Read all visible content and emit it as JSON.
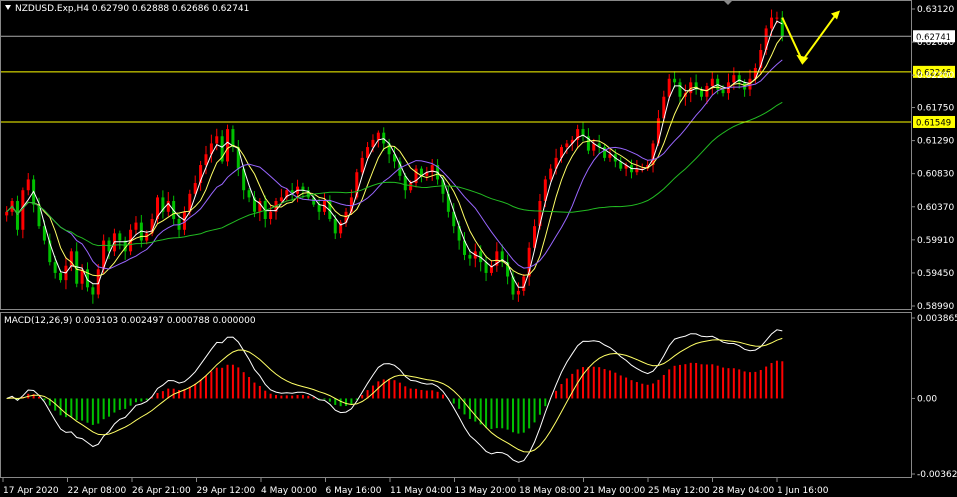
{
  "window": {
    "symbol_header": "NZDUSD.Exp,H4  0.62790 0.62888 0.62686 0.62741",
    "macd_header": "MACD(12,26,9) 0.003103 0.002497 0.000788 0.000000"
  },
  "colors": {
    "background": "#000000",
    "bull": "#ff0000",
    "bear": "#00c000",
    "ma_fast": "#ffffff",
    "ma_mid": "#ffff66",
    "ma_slow": "#9966ff",
    "ma_long": "#22bb22",
    "level_line": "#ffff00",
    "current_line": "#aaaaaa",
    "arrow": "#ffff00"
  },
  "chart_data": [
    {
      "type": "candlestick",
      "title": "NZDUSD.Exp,H4",
      "ohlc_last": {
        "open": 0.6279,
        "high": 0.62888,
        "low": 0.62686,
        "close": 0.62741
      },
      "ylim": [
        0.5899,
        0.6312
      ],
      "y_ticks": [
        "0.63120",
        "0.62660",
        "0.62200",
        "0.61750",
        "0.61290",
        "0.60830",
        "0.60370",
        "0.59910",
        "0.59450",
        "0.58990"
      ],
      "levels": [
        {
          "label": "0.62246",
          "value": 0.62246
        },
        {
          "label": "0.61549",
          "value": 0.61549
        }
      ],
      "current_price_label": "0.62741",
      "x_ticks": [
        "17 Apr 2020",
        "22 Apr 08:00",
        "26 Apr 21:00",
        "29 Apr 12:00",
        "4 May 00:00",
        "6 May 16:00",
        "11 May 04:00",
        "13 May 20:00",
        "18 May 08:00",
        "21 May 00:00",
        "25 May 12:00",
        "28 May 04:00",
        "1 Jun 16:00"
      ],
      "close_path": [
        0.603,
        0.6045,
        0.6005,
        0.606,
        0.6075,
        0.604,
        0.601,
        0.599,
        0.596,
        0.5945,
        0.5935,
        0.5955,
        0.5975,
        0.593,
        0.595,
        0.5925,
        0.5915,
        0.595,
        0.599,
        0.5975,
        0.6,
        0.599,
        0.5975,
        0.6005,
        0.6015,
        0.599,
        0.6,
        0.602,
        0.605,
        0.603,
        0.6045,
        0.602,
        0.6005,
        0.603,
        0.6055,
        0.607,
        0.6095,
        0.611,
        0.6125,
        0.6135,
        0.61,
        0.6145,
        0.612,
        0.609,
        0.606,
        0.605,
        0.603,
        0.6045,
        0.602,
        0.603,
        0.6045,
        0.605,
        0.606,
        0.6055,
        0.6065,
        0.606,
        0.605,
        0.604,
        0.603,
        0.6045,
        0.602,
        0.6,
        0.6015,
        0.603,
        0.605,
        0.6085,
        0.6105,
        0.612,
        0.613,
        0.614,
        0.6125,
        0.611,
        0.61,
        0.608,
        0.606,
        0.607,
        0.609,
        0.608,
        0.6085,
        0.6095,
        0.6075,
        0.6055,
        0.603,
        0.601,
        0.599,
        0.597,
        0.5965,
        0.5975,
        0.596,
        0.5945,
        0.5955,
        0.5975,
        0.596,
        0.594,
        0.5915,
        0.592,
        0.594,
        0.598,
        0.601,
        0.6045,
        0.6075,
        0.609,
        0.6105,
        0.612,
        0.6125,
        0.613,
        0.6145,
        0.6135,
        0.6115,
        0.6125,
        0.612,
        0.6105,
        0.611,
        0.61,
        0.609,
        0.6095,
        0.6085,
        0.609,
        0.609,
        0.6095,
        0.6125,
        0.616,
        0.619,
        0.6215,
        0.621,
        0.619,
        0.6195,
        0.621,
        0.62,
        0.619,
        0.6205,
        0.6215,
        0.62,
        0.6195,
        0.621,
        0.622,
        0.621,
        0.62,
        0.6215,
        0.623,
        0.6255,
        0.6285,
        0.63,
        0.63,
        0.6274
      ]
    },
    {
      "type": "bar",
      "title": "MACD(12,26,9)",
      "values_header": {
        "main": 0.003103,
        "signal": 0.002497,
        "histogram": 0.000788,
        "zero": 0.0
      },
      "ylim": [
        -0.003629,
        0.003865
      ],
      "y_ticks": [
        "0.003865",
        "0.00",
        "-0.003629"
      ]
    }
  ]
}
